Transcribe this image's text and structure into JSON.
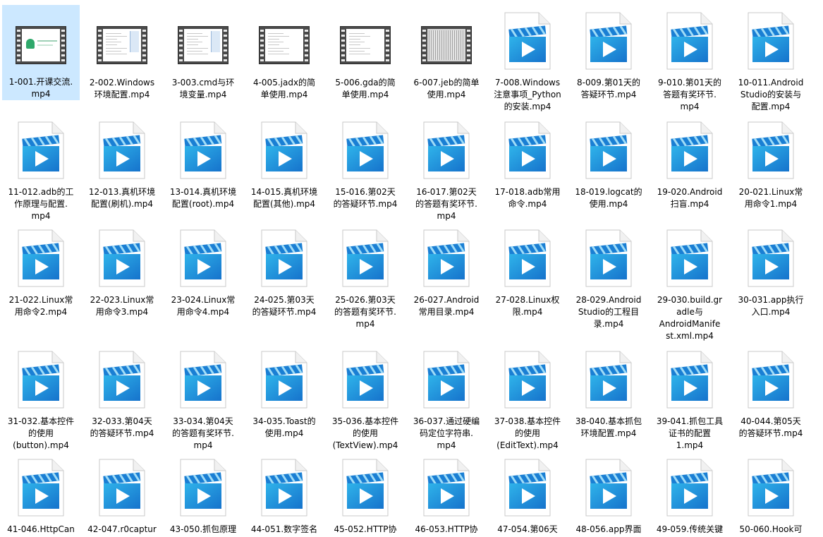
{
  "files": [
    {
      "label": "1-001.开课交流.\nmp4",
      "thumb": "video-1"
    },
    {
      "label": "2-002.Windows\n环境配置.mp4",
      "thumb": "video-2"
    },
    {
      "label": "3-003.cmd与环\n境变量.mp4",
      "thumb": "video-3"
    },
    {
      "label": "4-005.jadx的简\n单使用.mp4",
      "thumb": "video-4"
    },
    {
      "label": "5-006.gda的简\n单使用.mp4",
      "thumb": "video-5"
    },
    {
      "label": "6-007.jeb的简单\n使用.mp4",
      "thumb": "video-6"
    },
    {
      "label": "7-008.Windows\n注意事项_Python\n的安装.mp4",
      "thumb": "mp4-icon"
    },
    {
      "label": "8-009.第01天的\n答疑环节.mp4",
      "thumb": "mp4-icon"
    },
    {
      "label": "9-010.第01天的\n答题有奖环节.\nmp4",
      "thumb": "mp4-icon"
    },
    {
      "label": "10-011.Android\nStudio的安装与\n配置.mp4",
      "thumb": "mp4-icon"
    },
    {
      "label": "11-012.adb的工\n作原理与配置.\nmp4",
      "thumb": "mp4-icon"
    },
    {
      "label": "12-013.真机环境\n配置(刷机).mp4",
      "thumb": "mp4-icon"
    },
    {
      "label": "13-014.真机环境\n配置(root).mp4",
      "thumb": "mp4-icon"
    },
    {
      "label": "14-015.真机环境\n配置(其他).mp4",
      "thumb": "mp4-icon"
    },
    {
      "label": "15-016.第02天\n的答疑环节.mp4",
      "thumb": "mp4-icon"
    },
    {
      "label": "16-017.第02天\n的答题有奖环节.\nmp4",
      "thumb": "mp4-icon"
    },
    {
      "label": "17-018.adb常用\n命令.mp4",
      "thumb": "mp4-icon"
    },
    {
      "label": "18-019.logcat的\n使用.mp4",
      "thumb": "mp4-icon"
    },
    {
      "label": "19-020.Android\n扫盲.mp4",
      "thumb": "mp4-icon"
    },
    {
      "label": "20-021.Linux常\n用命令1.mp4",
      "thumb": "mp4-icon"
    },
    {
      "label": "21-022.Linux常\n用命令2.mp4",
      "thumb": "mp4-icon"
    },
    {
      "label": "22-023.Linux常\n用命令3.mp4",
      "thumb": "mp4-icon"
    },
    {
      "label": "23-024.Linux常\n用命令4.mp4",
      "thumb": "mp4-icon"
    },
    {
      "label": "24-025.第03天\n的答疑环节.mp4",
      "thumb": "mp4-icon"
    },
    {
      "label": "25-026.第03天\n的答题有奖环节.\nmp4",
      "thumb": "mp4-icon"
    },
    {
      "label": "26-027.Android\n常用目录.mp4",
      "thumb": "mp4-icon"
    },
    {
      "label": "27-028.Linux权\n限.mp4",
      "thumb": "mp4-icon"
    },
    {
      "label": "28-029.Android\nStudio的工程目\n录.mp4",
      "thumb": "mp4-icon"
    },
    {
      "label": "29-030.build.gr\nadle与\nAndroidManife\nst.xml.mp4",
      "thumb": "mp4-icon"
    },
    {
      "label": "30-031.app执行\n入口.mp4",
      "thumb": "mp4-icon"
    },
    {
      "label": "31-032.基本控件\n的使用\n(button).mp4",
      "thumb": "mp4-icon"
    },
    {
      "label": "32-033.第04天\n的答疑环节.mp4",
      "thumb": "mp4-icon"
    },
    {
      "label": "33-034.第04天\n的答题有奖环节.\nmp4",
      "thumb": "mp4-icon"
    },
    {
      "label": "34-035.Toast的\n使用.mp4",
      "thumb": "mp4-icon"
    },
    {
      "label": "35-036.基本控件\n的使用\n(TextView).mp4",
      "thumb": "mp4-icon"
    },
    {
      "label": "36-037.通过硬编\n码定位字符串.\nmp4",
      "thumb": "mp4-icon"
    },
    {
      "label": "37-038.基本控件\n的使用\n(EditText).mp4",
      "thumb": "mp4-icon"
    },
    {
      "label": "38-040.基本抓包\n环境配置.mp4",
      "thumb": "mp4-icon"
    },
    {
      "label": "39-041.抓包工具\n证书的配置\n1.mp4",
      "thumb": "mp4-icon"
    },
    {
      "label": "40-044.第05天\n的答疑环节.mp4",
      "thumb": "mp4-icon"
    },
    {
      "label": "41-046.HttpCan",
      "thumb": "mp4-icon"
    },
    {
      "label": "42-047.r0captur",
      "thumb": "mp4-icon"
    },
    {
      "label": "43-050.抓包原理",
      "thumb": "mp4-icon"
    },
    {
      "label": "44-051.数字签名",
      "thumb": "mp4-icon"
    },
    {
      "label": "45-052.HTTP协",
      "thumb": "mp4-icon"
    },
    {
      "label": "46-053.HTTP协",
      "thumb": "mp4-icon"
    },
    {
      "label": "47-054.第06天",
      "thumb": "mp4-icon"
    },
    {
      "label": "48-056.app界面",
      "thumb": "mp4-icon"
    },
    {
      "label": "49-059.传统关键",
      "thumb": "mp4-icon"
    },
    {
      "label": "50-060.Hook可",
      "thumb": "mp4-icon"
    }
  ],
  "selected_index": 0,
  "colors": {
    "selection": "#cce8ff",
    "icon_blue": "#1a7fd4",
    "icon_light": "#2fb3ea"
  }
}
